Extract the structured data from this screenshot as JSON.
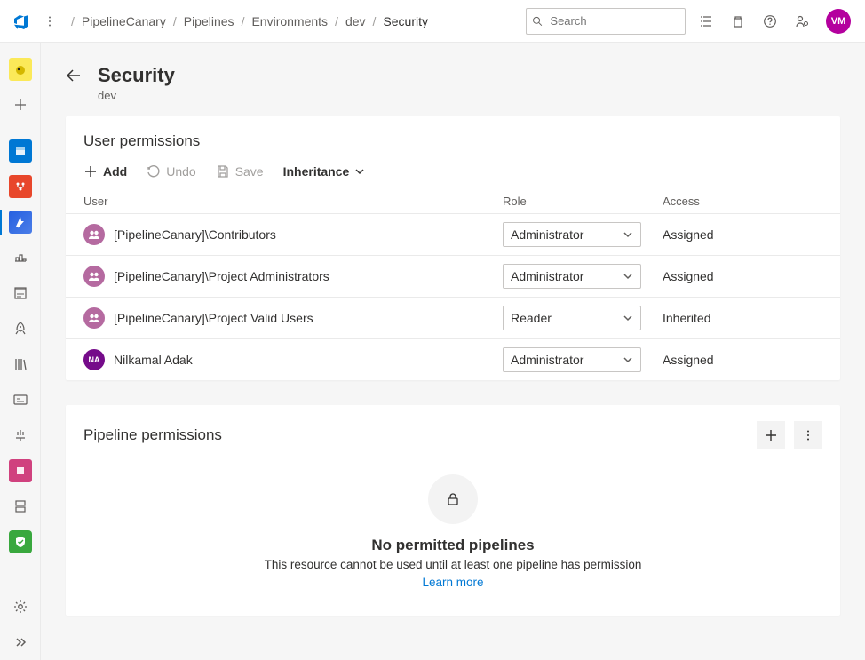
{
  "breadcrumbs": [
    "PipelineCanary",
    "Pipelines",
    "Environments",
    "dev",
    "Security"
  ],
  "search": {
    "placeholder": "Search"
  },
  "avatar": {
    "initials": "VM"
  },
  "page": {
    "title": "Security",
    "subtitle": "dev"
  },
  "userperm": {
    "title": "User permissions",
    "toolbar": {
      "add": "Add",
      "undo": "Undo",
      "save": "Save",
      "inheritance": "Inheritance"
    },
    "columns": {
      "user": "User",
      "role": "Role",
      "access": "Access"
    },
    "rows": [
      {
        "name": "[PipelineCanary]\\Contributors",
        "type": "group",
        "role": "Administrator",
        "access": "Assigned"
      },
      {
        "name": "[PipelineCanary]\\Project Administrators",
        "type": "group",
        "role": "Administrator",
        "access": "Assigned"
      },
      {
        "name": "[PipelineCanary]\\Project Valid Users",
        "type": "group",
        "role": "Reader",
        "access": "Inherited"
      },
      {
        "name": "Nilkamal Adak",
        "type": "user",
        "initials": "NA",
        "role": "Administrator",
        "access": "Assigned"
      }
    ]
  },
  "pipeperm": {
    "title": "Pipeline permissions",
    "empty": {
      "heading": "No permitted pipelines",
      "body": "This resource cannot be used until at least one pipeline has permission",
      "link": "Learn more"
    }
  },
  "leftrail": [
    {
      "name": "project-avatar",
      "color": "#fbe959"
    },
    {
      "name": "add",
      "color": "transparent"
    },
    {
      "name": "boards",
      "color": "#0078d4"
    },
    {
      "name": "repos",
      "color": "#e8472b"
    },
    {
      "name": "pipelines",
      "color": "#174ea6",
      "selected": true
    },
    {
      "name": "artifacts",
      "color": "transparent"
    },
    {
      "name": "testplans",
      "color": "transparent"
    },
    {
      "name": "rocket",
      "color": "transparent"
    },
    {
      "name": "library",
      "color": "transparent"
    },
    {
      "name": "dashboards",
      "color": "transparent"
    },
    {
      "name": "monitor",
      "color": "transparent"
    },
    {
      "name": "deploy",
      "color": "#d0417e"
    },
    {
      "name": "services",
      "color": "transparent"
    },
    {
      "name": "security",
      "color": "#39a83e"
    }
  ]
}
